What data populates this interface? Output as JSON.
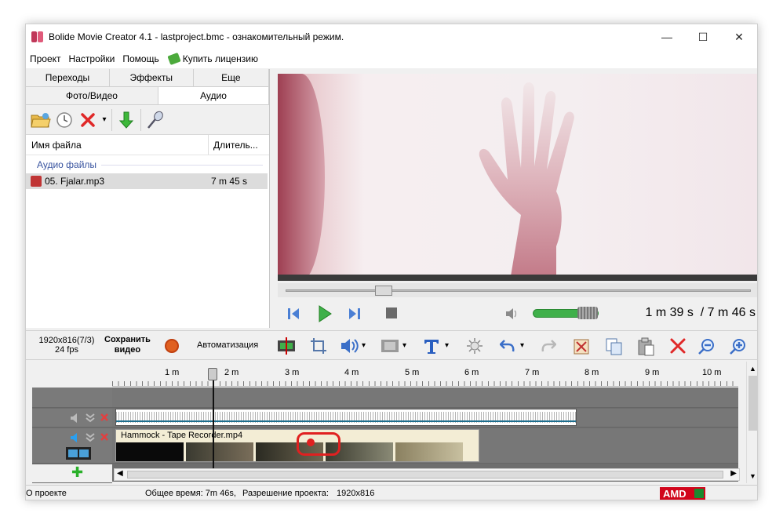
{
  "window": {
    "title": "Bolide Movie Creator 4.1 - lastproject.bmc  - ознакомительный режим.",
    "minimize": "—",
    "maximize": "☐",
    "close": "✕"
  },
  "menu": {
    "project": "Проект",
    "settings": "Настройки",
    "help": "Помощь",
    "buy": "Купить лицензию"
  },
  "left_panel": {
    "tabs_row1": [
      "Переходы",
      "Эффекты",
      "Еще"
    ],
    "tabs_row2": [
      "Фото/Видео",
      "Аудио"
    ],
    "col_name": "Имя файла",
    "col_duration": "Длитель...",
    "group": "Аудио файлы",
    "files": [
      {
        "name": "05. Fjalar.mp3",
        "duration": "7 m 45 s"
      }
    ]
  },
  "player": {
    "current_time": "1 m 39 s",
    "total_time": "/ 7 m 46 s",
    "seek_fraction": 0.21,
    "volume_fraction": 0.85
  },
  "bottom_toolbar": {
    "resolution": "1920x816(7/3)",
    "fps": "24 fps",
    "save_line1": "Сохранить",
    "save_line2": "видео",
    "automation": "Автоматизация"
  },
  "timeline": {
    "ticks": [
      "1 m",
      "2 m",
      "3 m",
      "4 m",
      "5 m",
      "6 m",
      "7 m",
      "8 m",
      "9 m",
      "10 m"
    ],
    "video_clip_title": "Hammock - Tape Recorder.mp4"
  },
  "status": {
    "about": "О проекте",
    "total_time": "Общее время: 7m 46s,",
    "resolution_label": "Разрешение проекта:",
    "resolution_value": "1920x816",
    "amd": "AMD"
  }
}
